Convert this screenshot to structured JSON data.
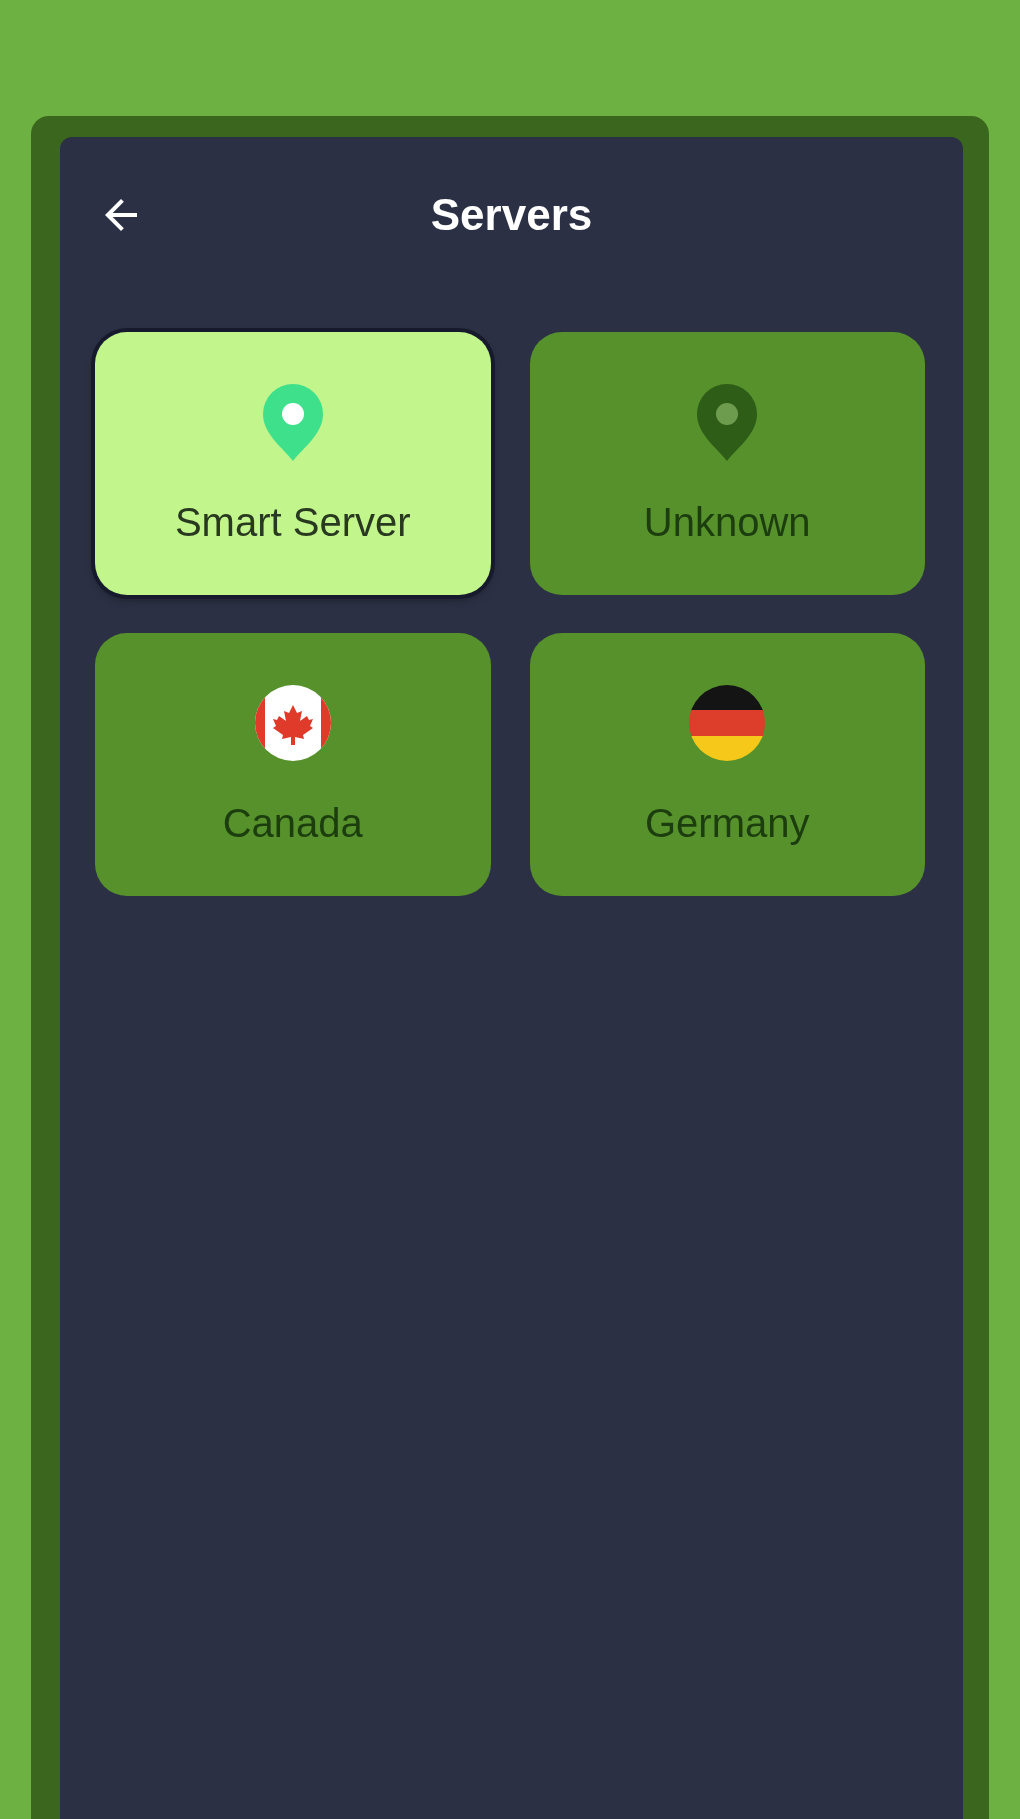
{
  "header": {
    "title": "Servers"
  },
  "servers": [
    {
      "name": "Smart Server",
      "kind": "pin",
      "selected": true
    },
    {
      "name": "Unknown",
      "kind": "pin",
      "selected": false
    },
    {
      "name": "Canada",
      "kind": "canada",
      "selected": false
    },
    {
      "name": "Germany",
      "kind": "germany",
      "selected": false
    }
  ]
}
